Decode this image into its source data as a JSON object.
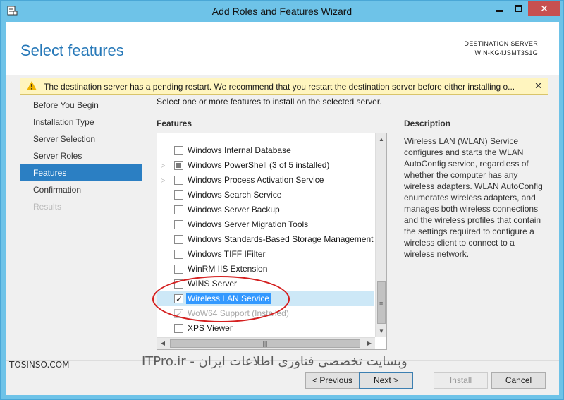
{
  "window": {
    "title": "Add Roles and Features Wizard"
  },
  "header": {
    "page_title": "Select features",
    "destination_label": "DESTINATION SERVER",
    "destination_name": "WIN-KG4JSMT3S1G"
  },
  "warning": {
    "text": "The destination server has a pending restart. We recommend that you restart the destination server before either installing o..."
  },
  "nav": {
    "items": [
      {
        "label": "Before You Begin",
        "state": "normal"
      },
      {
        "label": "Installation Type",
        "state": "normal"
      },
      {
        "label": "Server Selection",
        "state": "normal"
      },
      {
        "label": "Server Roles",
        "state": "normal"
      },
      {
        "label": "Features",
        "state": "active"
      },
      {
        "label": "Confirmation",
        "state": "normal"
      },
      {
        "label": "Results",
        "state": "disabled"
      }
    ]
  },
  "main": {
    "instruction": "Select one or more features to install on the selected server.",
    "features_label": "Features",
    "features": [
      {
        "label": "Windows Internal Database",
        "checked": "none",
        "expander": false
      },
      {
        "label": "Windows PowerShell (3 of 5 installed)",
        "checked": "partial",
        "expander": true
      },
      {
        "label": "Windows Process Activation Service",
        "checked": "none",
        "expander": true
      },
      {
        "label": "Windows Search Service",
        "checked": "none",
        "expander": false
      },
      {
        "label": "Windows Server Backup",
        "checked": "none",
        "expander": false
      },
      {
        "label": "Windows Server Migration Tools",
        "checked": "none",
        "expander": false
      },
      {
        "label": "Windows Standards-Based Storage Management",
        "checked": "none",
        "expander": false
      },
      {
        "label": "Windows TIFF IFilter",
        "checked": "none",
        "expander": false
      },
      {
        "label": "WinRM IIS Extension",
        "checked": "none",
        "expander": false
      },
      {
        "label": "WINS Server",
        "checked": "none",
        "expander": false
      },
      {
        "label": "Wireless LAN Service",
        "checked": "checked",
        "expander": false,
        "selected": true
      },
      {
        "label": "WoW64 Support (Installed)",
        "checked": "disabled",
        "expander": false
      },
      {
        "label": "XPS Viewer",
        "checked": "none",
        "expander": false
      }
    ]
  },
  "description": {
    "label": "Description",
    "text": "Wireless LAN (WLAN) Service configures and starts the WLAN AutoConfig service, regardless of whether the computer has any wireless adapters. WLAN AutoConfig enumerates wireless adapters, and manages both wireless connections and the wireless profiles that contain the settings required to configure a wireless client to connect to a wireless network."
  },
  "footer": {
    "previous": "< Previous",
    "next": "Next >",
    "install": "Install",
    "cancel": "Cancel"
  },
  "watermark": {
    "left": "TOSINSO.COM",
    "right": "وبسایت تخصصی فناوری اطلاعات ایران - ITPro.ir"
  }
}
